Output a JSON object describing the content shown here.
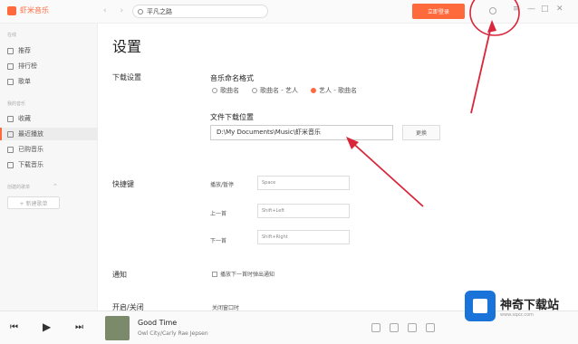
{
  "app": {
    "logo_text": "虾米音乐"
  },
  "header": {
    "nav_arrows": "‹ ›",
    "search_value": "平凡之路",
    "login_label": "立即登录",
    "window_controls": {
      "menu": "≡",
      "minimize": "—",
      "maximize": "□",
      "close": "✕"
    }
  },
  "sidebar": {
    "sections": [
      {
        "label": "在线"
      },
      {
        "label": "我的音乐"
      },
      {
        "label": "创建的歌单"
      }
    ],
    "items": [
      {
        "label": "推荐",
        "icon": "music-note-icon"
      },
      {
        "label": "排行榜",
        "icon": "trophy-icon"
      },
      {
        "label": "歌单",
        "icon": "playlist-icon"
      },
      {
        "label": "收藏",
        "icon": "heart-icon"
      },
      {
        "label": "最近播放",
        "icon": "history-icon",
        "active": true
      },
      {
        "label": "已购音乐",
        "icon": "cart-icon"
      },
      {
        "label": "下载音乐",
        "icon": "download-icon"
      }
    ],
    "section_toggle": "⌃",
    "new_playlist": "+ 新建歌单"
  },
  "settings": {
    "title": "设置",
    "download_section": "下载设置",
    "naming_title": "音乐命名格式",
    "naming_options": [
      {
        "label": "歌曲名",
        "selected": false
      },
      {
        "label": "歌曲名 - 艺人",
        "selected": false
      },
      {
        "label": "艺人 - 歌曲名",
        "selected": true
      }
    ],
    "location_title": "文件下载位置",
    "location_path": "D:\\My Documents\\Music\\虾米音乐",
    "change_label": "更换",
    "hotkeys_section": "快捷键",
    "hotkeys": [
      {
        "label": "播放/暂停",
        "value": "Space"
      },
      {
        "label": "上一首",
        "value": "Shift+Left"
      },
      {
        "label": "下一首",
        "value": "Shift+Right"
      }
    ],
    "notify_section": "通知",
    "notify_option": "播放下一首时弹出通知",
    "startup_section": "开启/关闭",
    "close_option": "关闭窗口时"
  },
  "player": {
    "prev": "⏮",
    "play": "▶",
    "next": "⏭",
    "song_title": "Good Time",
    "artist": "Owl City/Carly Rae Jepsen"
  },
  "watermark": {
    "title": "神奇下载站",
    "url": "www.sqxz.com"
  },
  "colors": {
    "accent": "#ff6a3d",
    "annotation": "#d9263b"
  }
}
